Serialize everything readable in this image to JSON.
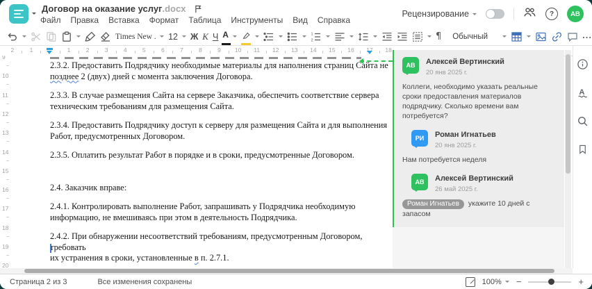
{
  "header": {
    "title": "Договор на оказание услуг",
    "title_ext": ".docx",
    "menu": [
      "Файл",
      "Правка",
      "Вставка",
      "Формат",
      "Таблица",
      "Инструменты",
      "Вид",
      "Справка"
    ],
    "review_label": "Рецензирование",
    "avatar_initials": "АВ",
    "avatar_color": "#2fc05f"
  },
  "toolbar": {
    "font_name": "Times New ...",
    "font_size": "12",
    "bold_letter": "Ж",
    "italic_letter": "К",
    "underline_letter": "Ч",
    "font_color_letter": "А",
    "style_name": "Обычный"
  },
  "icons": {
    "help_glyph": "?",
    "paragraph_mark": "¶",
    "more_ellipsis": "...",
    "spellcheck_letter": "А",
    "zoom_minus": "−",
    "zoom_plus": "+"
  },
  "ruler": {
    "h_negative": [
      "2",
      "1"
    ],
    "h_positive": [
      "1",
      "2",
      "3",
      "4",
      "5",
      "6",
      "7",
      "8",
      "9",
      "10",
      "11",
      "12",
      "13",
      "14",
      "15",
      "16",
      "17",
      "18"
    ],
    "v_numbers": [
      "9",
      "10",
      "11",
      "12",
      "13",
      "14",
      "15",
      "16",
      "17",
      "18",
      "19",
      "20"
    ]
  },
  "document": {
    "paragraphs": [
      {
        "runs": [
          {
            "t": "2.3.2. Предоставить Подрядчику необходимые материалы для наполнения страниц Сайта не\n"
          },
          {
            "t": "позднее",
            "wavy": true
          },
          {
            "t": " 2 (двух) дней с момента заключения Договора."
          }
        ]
      },
      {
        "runs": [
          {
            "t": "2.3.3. В случае размещения Сайта на сервере Заказчика, обеспечить соответствие сервера\nтехническим требованиям для размещения Сайта."
          }
        ]
      },
      {
        "runs": [
          {
            "t": "2.3.4. Предоставить Подрядчику доступ к серверу для размещения Сайта и для выполнения\nРабот, предусмотренных Договором."
          }
        ]
      },
      {
        "runs": [
          {
            "t": "2.3.5. Оплатить результат Работ в порядке и в сроки, предусмотренные Договором."
          }
        ]
      },
      {
        "gap_before": true,
        "runs": [
          {
            "t": "2.4. Заказчик вправе:"
          }
        ]
      },
      {
        "runs": [
          {
            "t": "2.4.1. Контролировать выполнение Работ, запрашивать у Подрядчика необходимую\nинформацию, не вмешиваясь при этом в деятельность Подрядчика."
          }
        ]
      },
      {
        "runs": [
          {
            "t": "2.4.2. При обнаружении несоответствий требованиям, предусмотренным Договором, требовать\nих устранения в сроки, установленные "
          },
          {
            "t": "в",
            "wavy": true
          },
          {
            "t": " п. 2.7.1."
          }
        ]
      }
    ]
  },
  "comments": {
    "accent_color": "#2bc34a",
    "thread": [
      {
        "initials": "АВ",
        "color": "#2fc05f",
        "name": "Алексей Вертинский",
        "date": "20 янв 2025 г.",
        "text": "Коллеги, необходимо указать реальные сроки предоставления материалов подрядчику. Сколько времени вам потребуется?",
        "reply": false
      },
      {
        "initials": "РИ",
        "color": "#309af2",
        "name": "Роман Игнатьев",
        "date": "20 янв 2025 г.",
        "text": "Нам потребуется неделя",
        "reply": true
      },
      {
        "initials": "АВ",
        "color": "#2fc05f",
        "name": "Алексей Вертинский",
        "date": "26 май 2025 г.",
        "mention": "Роман Игнатьев",
        "text": "укажите 10 дней с запасом",
        "reply": true
      }
    ]
  },
  "statusbar": {
    "page_label": "Страница 2 из 3",
    "saved_label": "Все изменения сохранены",
    "zoom_value": "100%"
  }
}
